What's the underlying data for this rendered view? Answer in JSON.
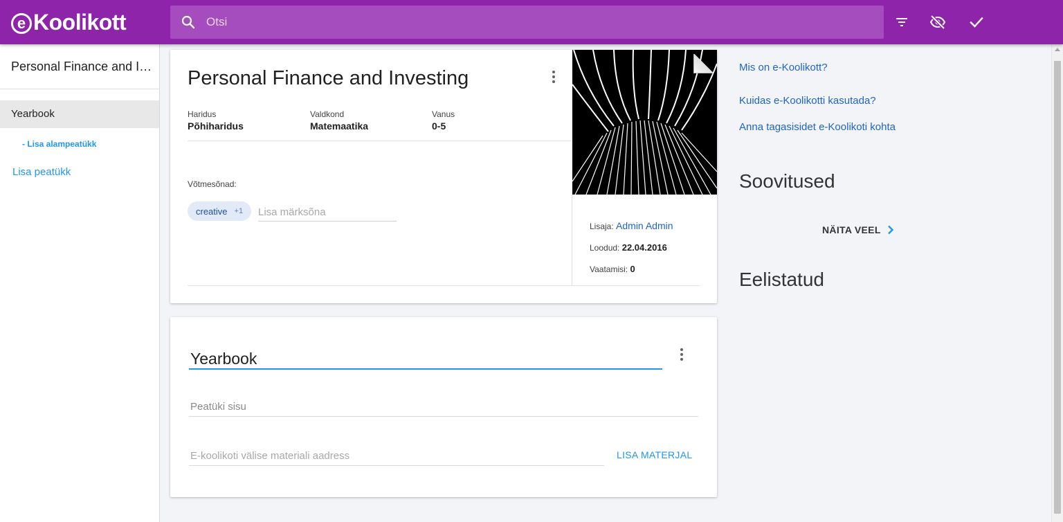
{
  "app": {
    "logo_text": "Koolikott",
    "logo_e": "e"
  },
  "search": {
    "placeholder": "Otsi",
    "value": ""
  },
  "toolbar": {
    "icons": [
      "filter-icon",
      "visibility-off-icon",
      "check-icon"
    ]
  },
  "sidebar": {
    "title": "Personal Finance and Investing",
    "items": [
      {
        "label": "Yearbook",
        "selected": true
      },
      {
        "label": "- Lisa alampeatükk"
      },
      {
        "label": "Lisa peatükk"
      }
    ]
  },
  "material": {
    "title": "Personal Finance and Investing",
    "meta": [
      {
        "label": "Haridus",
        "value": "Põhiharidus"
      },
      {
        "label": "Valdkond",
        "value": "Matemaatika"
      },
      {
        "label": "Vanus",
        "value": "0-5"
      }
    ],
    "keywords_label": "Võtmesõnad:",
    "keyword_chip": "creative",
    "keyword_extra": "+1",
    "keyword_input_placeholder": "Lisa märksõna",
    "added_by_label": "Lisaja:",
    "added_by": "Admin Admin",
    "created_label": "Loodud:",
    "created": "22.04.2016",
    "views_label": "Vaatamisi:",
    "views": "0"
  },
  "chapter": {
    "title": "Yearbook",
    "content_placeholder": "Peatüki sisu",
    "url_placeholder": "E-koolikoti välise materiali aadress",
    "add_material_label": "LISA MATERJAL"
  },
  "right": {
    "links": [
      "Mis on e-Koolikott?",
      "Kuidas e-Koolikotti kasutada?",
      "Anna tagasisidet e-Koolikoti kohta"
    ],
    "recommendations_heading": "Soovitused",
    "show_more_label": "NÄITA VEEL",
    "favorites_heading": "Eelistatud"
  },
  "colors": {
    "primary": "#8e24aa",
    "accent": "#2196f3",
    "link": "#1e64c8"
  }
}
